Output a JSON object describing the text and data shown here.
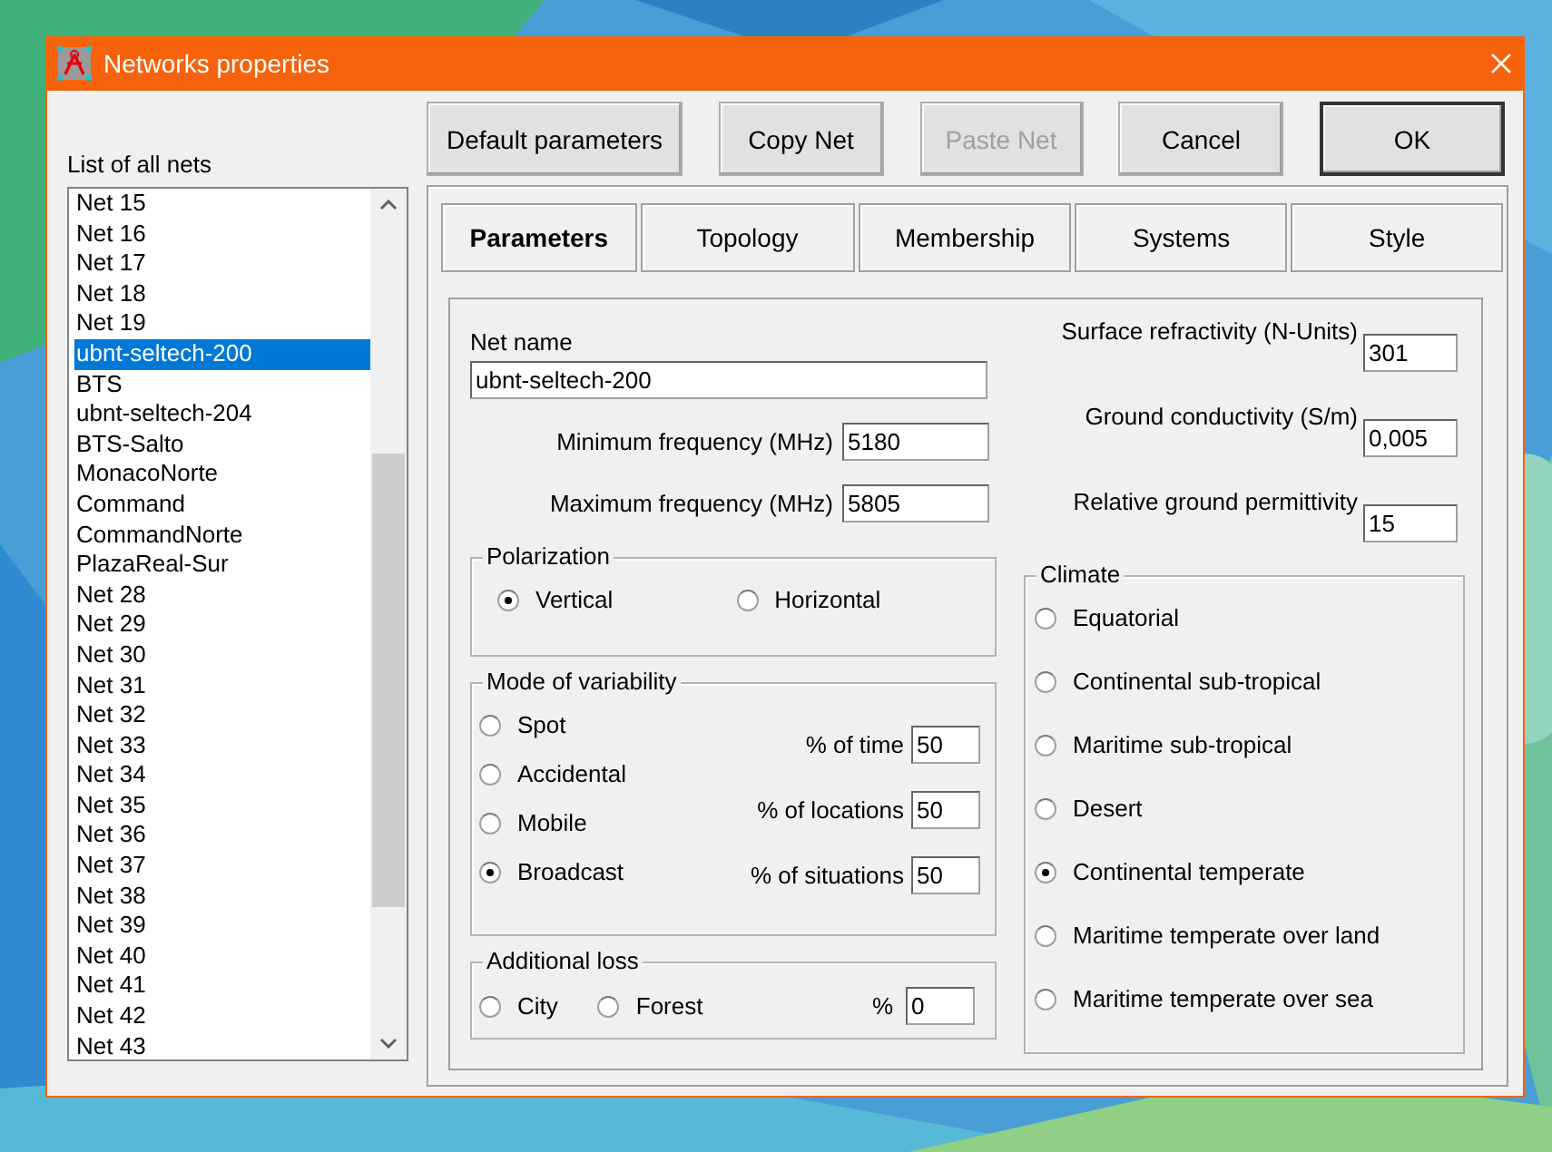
{
  "window": {
    "title": "Networks properties"
  },
  "net_list": {
    "label": "List of all nets",
    "items": [
      {
        "label": "Net 15",
        "selected": false
      },
      {
        "label": "Net 16",
        "selected": false
      },
      {
        "label": "Net 17",
        "selected": false
      },
      {
        "label": "Net 18",
        "selected": false
      },
      {
        "label": "Net 19",
        "selected": false
      },
      {
        "label": "ubnt-seltech-200",
        "selected": true
      },
      {
        "label": "BTS",
        "selected": false
      },
      {
        "label": "ubnt-seltech-204",
        "selected": false
      },
      {
        "label": "BTS-Salto",
        "selected": false
      },
      {
        "label": "MonacoNorte",
        "selected": false
      },
      {
        "label": "Command",
        "selected": false
      },
      {
        "label": "CommandNorte",
        "selected": false
      },
      {
        "label": "PlazaReal-Sur",
        "selected": false
      },
      {
        "label": "Net 28",
        "selected": false
      },
      {
        "label": "Net 29",
        "selected": false
      },
      {
        "label": "Net 30",
        "selected": false
      },
      {
        "label": "Net 31",
        "selected": false
      },
      {
        "label": "Net 32",
        "selected": false
      },
      {
        "label": "Net 33",
        "selected": false
      },
      {
        "label": "Net 34",
        "selected": false
      },
      {
        "label": "Net 35",
        "selected": false
      },
      {
        "label": "Net 36",
        "selected": false
      },
      {
        "label": "Net 37",
        "selected": false
      },
      {
        "label": "Net 38",
        "selected": false
      },
      {
        "label": "Net 39",
        "selected": false
      },
      {
        "label": "Net 40",
        "selected": false
      },
      {
        "label": "Net 41",
        "selected": false
      },
      {
        "label": "Net 42",
        "selected": false
      },
      {
        "label": "Net 43",
        "selected": false
      }
    ]
  },
  "buttons": [
    {
      "label": "Default parameters",
      "disabled": false,
      "default": false
    },
    {
      "label": "Copy Net",
      "disabled": false,
      "default": false
    },
    {
      "label": "Paste Net",
      "disabled": true,
      "default": false
    },
    {
      "label": "Cancel",
      "disabled": false,
      "default": false
    },
    {
      "label": "OK",
      "disabled": false,
      "default": true
    }
  ],
  "tabs": [
    {
      "label": "Parameters",
      "selected": true
    },
    {
      "label": "Topology",
      "selected": false
    },
    {
      "label": "Membership",
      "selected": false
    },
    {
      "label": "Systems",
      "selected": false
    },
    {
      "label": "Style",
      "selected": false
    }
  ],
  "net_name": {
    "label": "Net name",
    "value": "ubnt-seltech-200"
  },
  "frequencies": [
    {
      "label": "Minimum frequency (MHz)",
      "value": "5180"
    },
    {
      "label": "Maximum frequency (MHz)",
      "value": "5805"
    }
  ],
  "ground": [
    {
      "label": "Surface refractivity (N-Units)",
      "value": "301"
    },
    {
      "label": "Ground conductivity (S/m)",
      "value": "0,005"
    },
    {
      "label": "Relative ground permittivity",
      "value": "15"
    }
  ],
  "polarization": {
    "title": "Polarization",
    "options": [
      {
        "label": "Vertical",
        "selected": true
      },
      {
        "label": "Horizontal",
        "selected": false
      }
    ]
  },
  "variability": {
    "title": "Mode of variability",
    "options": [
      {
        "label": "Spot",
        "selected": false
      },
      {
        "label": "Accidental",
        "selected": false
      },
      {
        "label": "Mobile",
        "selected": false
      },
      {
        "label": "Broadcast",
        "selected": true
      }
    ],
    "fields": [
      {
        "label": "% of time",
        "value": "50"
      },
      {
        "label": "% of locations",
        "value": "50"
      },
      {
        "label": "% of situations",
        "value": "50"
      }
    ]
  },
  "additional_loss": {
    "title": "Additional loss",
    "options": [
      {
        "label": "City",
        "selected": false
      },
      {
        "label": "Forest",
        "selected": false
      }
    ],
    "field": {
      "label": "%",
      "value": "0"
    }
  },
  "climate": {
    "title": "Climate",
    "options": [
      {
        "label": "Equatorial",
        "selected": false
      },
      {
        "label": "Continental sub-tropical",
        "selected": false
      },
      {
        "label": "Maritime sub-tropical",
        "selected": false
      },
      {
        "label": "Desert",
        "selected": false
      },
      {
        "label": "Continental temperate",
        "selected": true
      },
      {
        "label": "Maritime temperate over land",
        "selected": false
      },
      {
        "label": "Maritime temperate over sea",
        "selected": false
      }
    ]
  }
}
